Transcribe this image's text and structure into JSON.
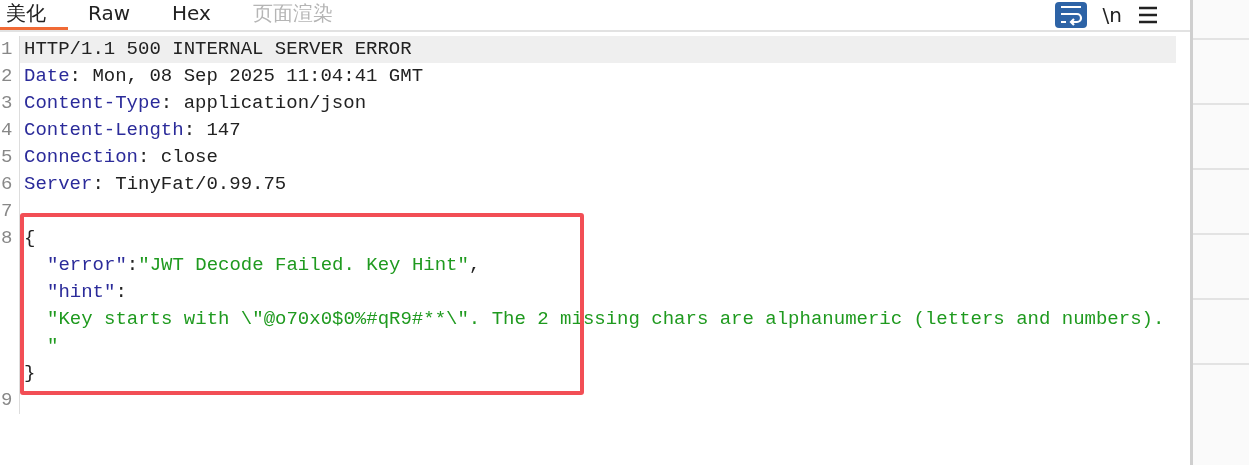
{
  "tabs": [
    {
      "label": "美化",
      "selected": true,
      "disabled": false
    },
    {
      "label": "Raw",
      "selected": false,
      "disabled": false
    },
    {
      "label": "Hex",
      "selected": false,
      "disabled": false
    },
    {
      "label": "页面渲染",
      "selected": false,
      "disabled": true
    }
  ],
  "toolbar": {
    "wrap_on": true,
    "newline_label": "\\n"
  },
  "lines": [
    {
      "number": "1",
      "current": true,
      "annotated": false,
      "rows": [
        {
          "indented": false,
          "parts": [
            {
              "kind": "plain",
              "text": "HTTP/1.1 500 INTERNAL SERVER ERROR"
            }
          ]
        }
      ]
    },
    {
      "number": "2",
      "current": false,
      "annotated": false,
      "rows": [
        {
          "indented": false,
          "parts": [
            {
              "kind": "header",
              "text": "Date"
            },
            {
              "kind": "plain",
              "text": ": Mon, 08 Sep 2025 11:04:41 GMT"
            }
          ]
        }
      ]
    },
    {
      "number": "3",
      "current": false,
      "annotated": false,
      "rows": [
        {
          "indented": false,
          "parts": [
            {
              "kind": "header",
              "text": "Content-Type"
            },
            {
              "kind": "plain",
              "text": ": application/json"
            }
          ]
        }
      ]
    },
    {
      "number": "4",
      "current": false,
      "annotated": false,
      "rows": [
        {
          "indented": false,
          "parts": [
            {
              "kind": "header",
              "text": "Content-Length"
            },
            {
              "kind": "plain",
              "text": ": 147"
            }
          ]
        }
      ]
    },
    {
      "number": "5",
      "current": false,
      "annotated": false,
      "rows": [
        {
          "indented": false,
          "parts": [
            {
              "kind": "header",
              "text": "Connection"
            },
            {
              "kind": "plain",
              "text": ": close"
            }
          ]
        }
      ]
    },
    {
      "number": "6",
      "current": false,
      "annotated": false,
      "rows": [
        {
          "indented": false,
          "parts": [
            {
              "kind": "header",
              "text": "Server"
            },
            {
              "kind": "plain",
              "text": ": TinyFat/0.99.75"
            }
          ]
        }
      ]
    },
    {
      "number": "7",
      "current": false,
      "annotated": false
    },
    {
      "number": "8",
      "current": false,
      "annotated": true,
      "rows": [
        {
          "indented": false,
          "parts": [
            {
              "kind": "plain",
              "text": "{"
            }
          ]
        },
        {
          "indented": true,
          "parts": [
            {
              "kind": "key",
              "text": "\"error\""
            },
            {
              "kind": "plain",
              "text": ":"
            },
            {
              "kind": "string",
              "text": "\"JWT Decode Failed. Key Hint\""
            },
            {
              "kind": "plain",
              "text": ","
            }
          ]
        },
        {
          "indented": true,
          "parts": [
            {
              "kind": "key",
              "text": "\"hint\""
            },
            {
              "kind": "plain",
              "text": ":"
            }
          ]
        },
        {
          "indented": true,
          "parts": [
            {
              "kind": "string",
              "text": "\"Key starts with \\\"@o70x0$0%#qR9#**\\\". The 2 missing chars are alphanumeric (letters and numbers)."
            }
          ]
        },
        {
          "indented": true,
          "parts": [
            {
              "kind": "string",
              "text": "\""
            }
          ]
        },
        {
          "indented": false,
          "parts": [
            {
              "kind": "plain",
              "text": "}"
            }
          ]
        }
      ]
    },
    {
      "number": "9",
      "current": false,
      "annotated": false
    }
  ]
}
